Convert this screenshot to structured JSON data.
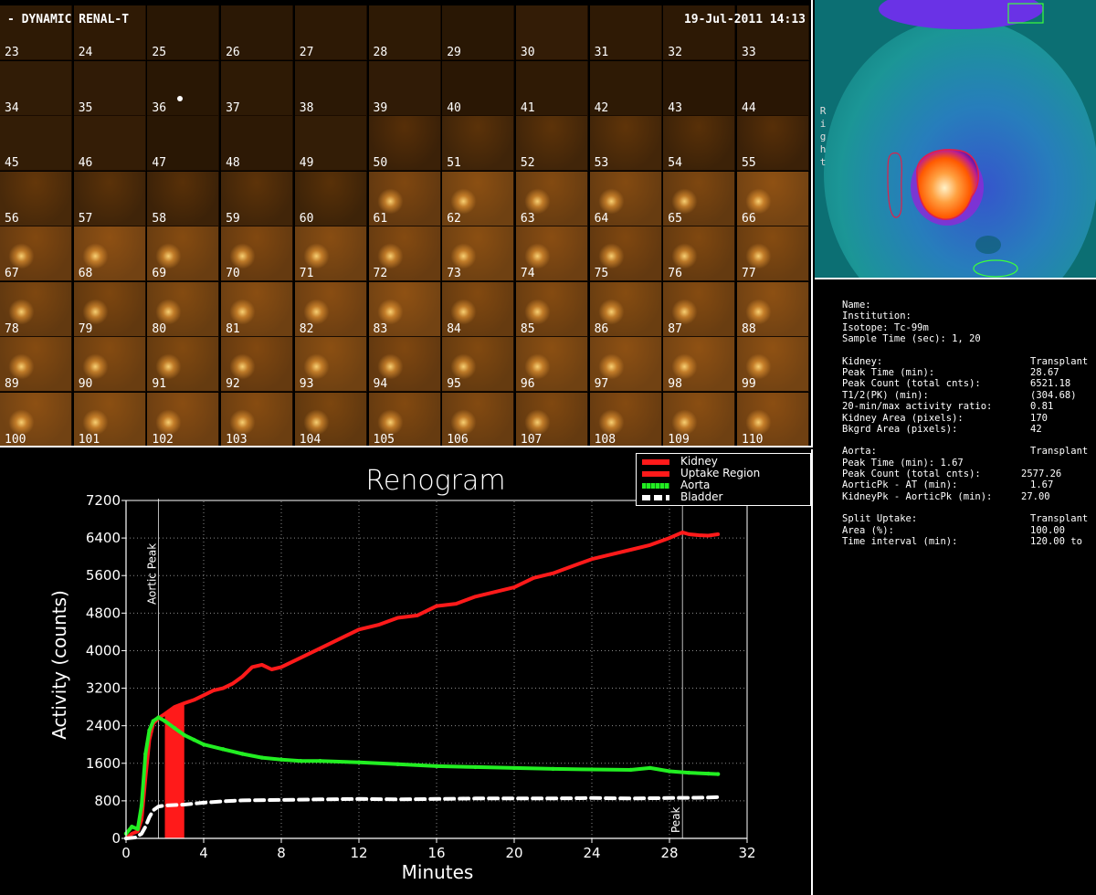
{
  "header": {
    "title": "- DYNAMIC RENAL-T",
    "datetime": "19-Jul-2011  14:13"
  },
  "frames": {
    "numbers": [
      "23",
      "24",
      "25",
      "26",
      "27",
      "28",
      "29",
      "30",
      "31",
      "32",
      "33",
      "34",
      "35",
      "36",
      "37",
      "38",
      "39",
      "40",
      "41",
      "42",
      "43",
      "44",
      "45",
      "46",
      "47",
      "48",
      "49",
      "50",
      "51",
      "52",
      "53",
      "54",
      "55",
      "56",
      "57",
      "58",
      "59",
      "60",
      "61",
      "62",
      "63",
      "64",
      "65",
      "66",
      "67",
      "68",
      "69",
      "70",
      "71",
      "72",
      "73",
      "74",
      "75",
      "76",
      "77",
      "78",
      "79",
      "80",
      "81",
      "82",
      "83",
      "84",
      "85",
      "86",
      "87",
      "88",
      "89",
      "90",
      "91",
      "92",
      "93",
      "94",
      "95",
      "96",
      "97",
      "98",
      "99",
      "100",
      "101",
      "102",
      "103",
      "104",
      "105",
      "106",
      "107",
      "108",
      "109",
      "110"
    ]
  },
  "image": {
    "side_label": "Right"
  },
  "stats": {
    "name_label": "Name:",
    "institution_label": "Institution:",
    "isotope_label": "Isotope: Tc-99m",
    "sample_time_label": "Sample Time (sec): 1, 20",
    "kidney_label": "Kidney:",
    "kidney_value": "Transplant",
    "peak_time_label": "Peak Time (min):",
    "peak_time_value": "28.67",
    "peak_count_label": "Peak Count (total cnts):",
    "peak_count_value": "6521.18",
    "t12_label": "T1/2(PK) (min):",
    "t12_value": "(304.68)",
    "ratio_label": "20-min/max activity ratio:",
    "ratio_value": "0.81",
    "kidney_area_label": "Kidney Area (pixels):",
    "kidney_area_value": "170",
    "bkgrd_area_label": "Bkgrd Area (pixels):",
    "bkgrd_area_value": "42",
    "aorta_label": "Aorta:",
    "aorta_value": "Transplant",
    "aorta_peak_time_label": "Peak Time (min): 1.67",
    "aorta_peak_count_label": "Peak Count (total cnts):",
    "aorta_peak_count_value": "2577.26",
    "aorticpk_at_label": "AorticPk - AT (min):",
    "aorticpk_at_value": "1.67",
    "kidneypk_label": "KidneyPk - AorticPk (min):",
    "kidneypk_value": "27.00",
    "split_label": "Split Uptake:",
    "split_value": "Transplant",
    "area_label": "Area (%):",
    "area_value": "100.00",
    "interval_label": "Time interval (min):",
    "interval_value": "120.00 to"
  },
  "colors": {
    "kidney": "#ff1a1a",
    "uptake_region": "#ff1a1a",
    "aorta": "#22ee22",
    "bladder": "#ffffff",
    "grid": "#8a8a8a"
  },
  "chart_data": {
    "type": "line",
    "title": "Renogram",
    "xlabel": "Minutes",
    "ylabel": "Activity (counts)",
    "xlim": [
      0,
      32
    ],
    "ylim": [
      0,
      7200
    ],
    "xticks": [
      "0",
      "4",
      "8",
      "12",
      "16",
      "20",
      "24",
      "28",
      "32"
    ],
    "yticks": [
      "0",
      "800",
      "1600",
      "2400",
      "3200",
      "4000",
      "4800",
      "5600",
      "6400",
      "7200"
    ],
    "grid": true,
    "legend_position": "top-right",
    "annotations": [
      {
        "text": "Aortic Peak",
        "x": 1.67
      },
      {
        "text": "Peak",
        "x": 28.67
      }
    ],
    "uptake_region": {
      "name": "Uptake Region",
      "x_start": 2.0,
      "x_end": 3.0
    },
    "series": [
      {
        "name": "Kidney",
        "x": [
          0,
          0.3,
          0.6,
          0.8,
          1.0,
          1.2,
          1.4,
          1.67,
          2.0,
          2.5,
          3.0,
          3.5,
          4.0,
          4.5,
          5.0,
          5.5,
          6.0,
          6.5,
          7.0,
          7.5,
          8.0,
          9.0,
          10.0,
          11.0,
          12.0,
          13.0,
          14.0,
          15.0,
          16.0,
          17.0,
          18.0,
          19.0,
          20.0,
          21.0,
          22.0,
          23.0,
          24.0,
          25.0,
          26.0,
          27.0,
          28.0,
          28.67,
          29.0,
          29.5,
          30.0,
          30.5
        ],
        "values": [
          0,
          100,
          150,
          400,
          1300,
          2100,
          2450,
          2560,
          2650,
          2800,
          2880,
          2950,
          3050,
          3150,
          3200,
          3300,
          3450,
          3650,
          3700,
          3600,
          3650,
          3850,
          4050,
          4250,
          4450,
          4550,
          4700,
          4750,
          4950,
          5000,
          5150,
          5250,
          5350,
          5550,
          5650,
          5800,
          5950,
          6050,
          6150,
          6250,
          6400,
          6521,
          6480,
          6460,
          6450,
          6480
        ]
      },
      {
        "name": "Aorta",
        "x": [
          0,
          0.3,
          0.6,
          0.8,
          1.0,
          1.2,
          1.4,
          1.67,
          2.0,
          2.5,
          3.0,
          3.5,
          4.0,
          5.0,
          6.0,
          7.0,
          8.0,
          9.0,
          10.0,
          12.0,
          14.0,
          16.0,
          18.0,
          20.0,
          22.0,
          24.0,
          26.0,
          27.0,
          28.0,
          29.0,
          30.0,
          30.5
        ],
        "values": [
          100,
          250,
          200,
          700,
          1800,
          2300,
          2500,
          2577,
          2500,
          2350,
          2200,
          2100,
          2000,
          1900,
          1800,
          1720,
          1680,
          1650,
          1650,
          1620,
          1580,
          1540,
          1520,
          1500,
          1480,
          1470,
          1460,
          1500,
          1430,
          1400,
          1380,
          1370
        ]
      },
      {
        "name": "Bladder",
        "x": [
          0,
          0.5,
          0.8,
          1.0,
          1.2,
          1.4,
          1.67,
          2.0,
          3.0,
          4.0,
          5.0,
          6.0,
          8.0,
          10.0,
          12.0,
          14.0,
          16.0,
          18.0,
          20.0,
          22.0,
          24.0,
          26.0,
          28.0,
          30.0,
          30.5
        ],
        "values": [
          0,
          20,
          100,
          250,
          450,
          600,
          680,
          700,
          720,
          760,
          790,
          810,
          820,
          830,
          840,
          830,
          840,
          850,
          850,
          850,
          860,
          850,
          860,
          870,
          880
        ]
      }
    ]
  }
}
